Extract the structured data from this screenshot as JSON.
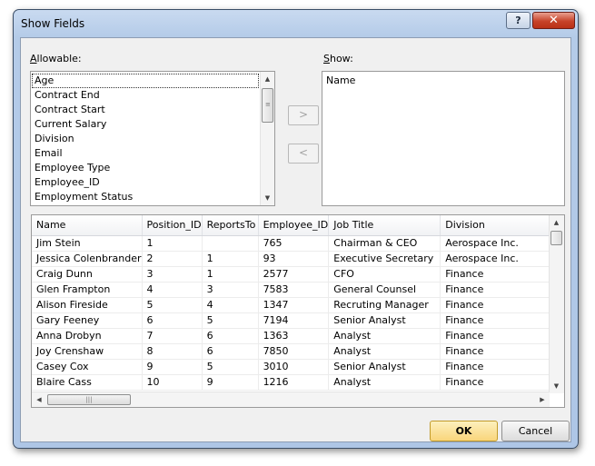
{
  "dialog": {
    "title": "Show Fields",
    "help_label": "?",
    "close_label": "✕"
  },
  "allowable": {
    "label_prefix": "",
    "label_mnemonic": "A",
    "label_rest": "llowable:",
    "items": [
      "Age",
      "Contract End",
      "Contract Start",
      "Current Salary",
      "Division",
      "Email",
      "Employee Type",
      "Employee_ID",
      "Employment Status"
    ],
    "selected": "Age"
  },
  "show": {
    "label_mnemonic": "S",
    "label_rest": "how:",
    "items": [
      "Name"
    ]
  },
  "move_buttons": {
    "add_label": ">",
    "remove_label": "<"
  },
  "grid": {
    "columns": [
      "Name",
      "Position_ID",
      "ReportsTo",
      "Employee_ID",
      "Job Title",
      "Division"
    ],
    "rows": [
      [
        "Jim Stein",
        "1",
        "",
        "765",
        "Chairman & CEO",
        "Aerospace Inc."
      ],
      [
        "Jessica Colenbrander",
        "2",
        "1",
        "93",
        "Executive Secretary",
        "Aerospace Inc."
      ],
      [
        "Craig Dunn",
        "3",
        "1",
        "2577",
        "CFO",
        "Finance"
      ],
      [
        "Glen Frampton",
        "4",
        "3",
        "7583",
        "General Counsel",
        "Finance"
      ],
      [
        "Alison Fireside",
        "5",
        "4",
        "1347",
        "Recruting Manager",
        "Finance"
      ],
      [
        "Gary Feeney",
        "6",
        "5",
        "7194",
        "Senior Analyst",
        "Finance"
      ],
      [
        "Anna Drobyn",
        "7",
        "6",
        "1363",
        "Analyst",
        "Finance"
      ],
      [
        "Joy Crenshaw",
        "8",
        "6",
        "7850",
        "Analyst",
        "Finance"
      ],
      [
        "Casey Cox",
        "9",
        "5",
        "3010",
        "Senior Analyst",
        "Finance"
      ],
      [
        "Blaire Cass",
        "10",
        "9",
        "1216",
        "Analyst",
        "Finance"
      ]
    ]
  },
  "buttons": {
    "ok": "OK",
    "cancel": "Cancel"
  },
  "icons": {
    "scroll_up": "▲",
    "scroll_down": "▼",
    "scroll_left": "◀",
    "scroll_right": "▶",
    "grip_vertical": "≡",
    "grip_horizontal": "|||"
  },
  "colors": {
    "accent_ok": "#f9d57b",
    "close_red": "#c7432a",
    "frame_blue": "#b4cbe8"
  }
}
